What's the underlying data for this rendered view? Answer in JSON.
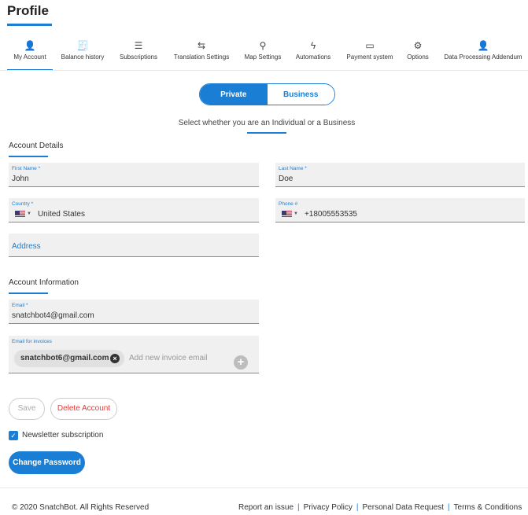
{
  "page": {
    "title": "Profile"
  },
  "tabs": [
    {
      "label": "My Account",
      "icon": "person-icon",
      "glyph": "👤"
    },
    {
      "label": "Balance history",
      "icon": "receipt-icon",
      "glyph": "🧾"
    },
    {
      "label": "Subscriptions",
      "icon": "checklist-icon",
      "glyph": "☰"
    },
    {
      "label": "Translation Settings",
      "icon": "translate-icon",
      "glyph": "⇆"
    },
    {
      "label": "Map Settings",
      "icon": "map-icon",
      "glyph": "⚲"
    },
    {
      "label": "Automations",
      "icon": "bolt-icon",
      "glyph": "ϟ"
    },
    {
      "label": "Payment system",
      "icon": "credit-card-icon",
      "glyph": "▭"
    },
    {
      "label": "Options",
      "icon": "gear-icon",
      "glyph": "⚙"
    },
    {
      "label": "Data Processing Addendum",
      "icon": "person-settings-icon",
      "glyph": "👤"
    }
  ],
  "account_type": {
    "private_label": "Private",
    "business_label": "Business",
    "selected": "Private",
    "hint": "Select whether you are an Individual or a Business"
  },
  "account_details": {
    "heading": "Account Details",
    "first_name": {
      "label": "First Name *",
      "value": "John"
    },
    "last_name": {
      "label": "Last Name *",
      "value": "Doe"
    },
    "country": {
      "label": "Country *",
      "value": "United States"
    },
    "phone": {
      "label": "Phone #",
      "value": "+18005553535"
    },
    "address": {
      "placeholder": "Address"
    }
  },
  "account_info": {
    "heading": "Account Information",
    "email": {
      "label": "Email *",
      "value": "snatchbot4@gmail.com"
    },
    "invoice_emails": {
      "label": "Email for invoices",
      "chips": [
        "snatchbot6@gmail.com"
      ],
      "placeholder": "Add new invoice email"
    }
  },
  "actions": {
    "save": "Save",
    "delete": "Delete Account",
    "newsletter_label": "Newsletter subscription",
    "newsletter_checked": true,
    "change_password": "Change Password"
  },
  "footer": {
    "copyright": "© 2020 SnatchBot. All Rights Reserved",
    "links": [
      "Report an issue",
      "Privacy Policy",
      "Personal Data Request",
      "Terms & Conditions"
    ]
  },
  "colors": {
    "accent": "#1a7fd4",
    "danger": "#e53935",
    "field_bg": "#f0f0f0"
  }
}
